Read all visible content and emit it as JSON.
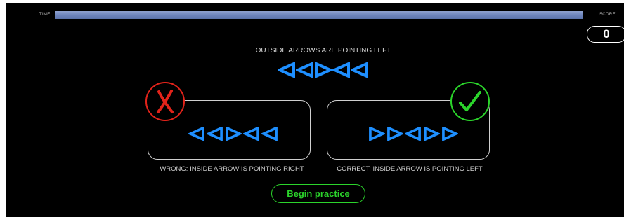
{
  "timer": {
    "label": "TIME",
    "remaining_fraction": 1.0
  },
  "score": {
    "label": "SCORE",
    "value": "0"
  },
  "instruction": {
    "text": "OUTSIDE ARROWS ARE POINTING LEFT"
  },
  "main_arrows": [
    "left",
    "left",
    "right",
    "left",
    "left"
  ],
  "examples": {
    "wrong": {
      "arrows": [
        "left",
        "left",
        "right",
        "left",
        "left"
      ],
      "caption": "WRONG: INSIDE ARROW IS POINTING RIGHT",
      "badge_icon": "x-mark-icon"
    },
    "correct": {
      "arrows": [
        "right",
        "right",
        "left",
        "right",
        "right"
      ],
      "caption": "CORRECT: INSIDE ARROW IS POINTING LEFT",
      "badge_icon": "check-mark-icon"
    }
  },
  "begin_button": {
    "label": "Begin practice"
  },
  "colors": {
    "background": "#000000",
    "arrow": "#1e8fff",
    "wrong": "#e2231a",
    "correct": "#2bd42b",
    "timer_bar": "#6f86bd"
  }
}
